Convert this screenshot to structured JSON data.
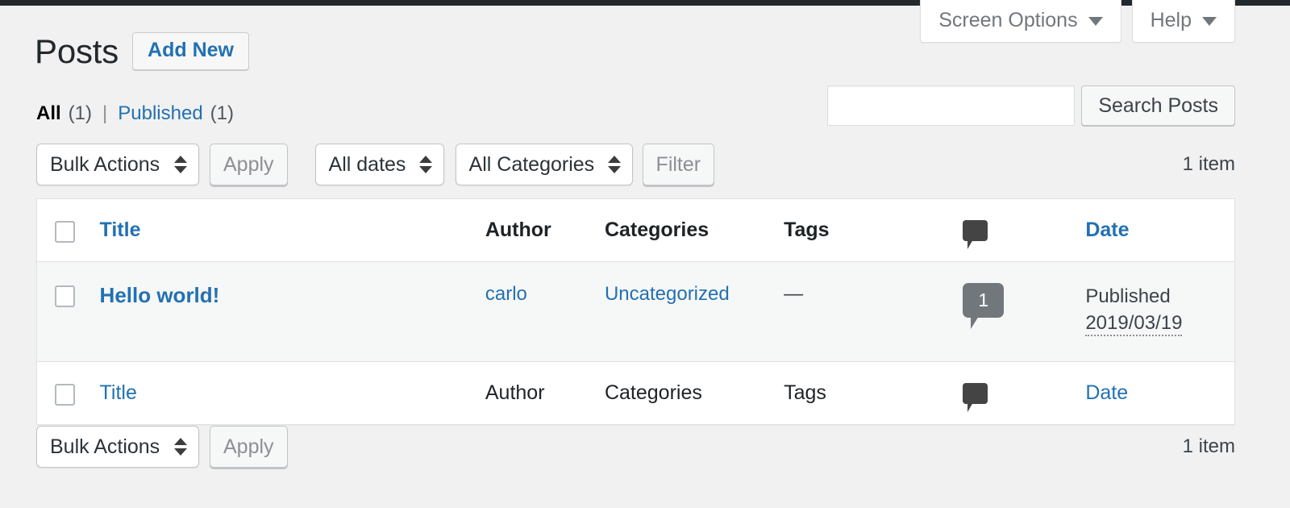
{
  "screen_meta": {
    "tabs": [
      {
        "label": "Screen Options",
        "icon": "chevron-down-icon"
      },
      {
        "label": "Help",
        "icon": "chevron-down-icon"
      }
    ]
  },
  "header": {
    "title": "Posts",
    "add_new_label": "Add New"
  },
  "views": {
    "all_label": "All",
    "all_count": "(1)",
    "separator": "|",
    "published_label": "Published",
    "published_count": "(1)"
  },
  "search": {
    "value": "",
    "placeholder": "",
    "submit_label": "Search Posts"
  },
  "tablenav_top": {
    "bulk_actions_selected": "Bulk Actions",
    "apply_label": "Apply",
    "dates_selected": "All dates",
    "categories_selected": "All Categories",
    "filter_label": "Filter",
    "displaying_num": "1 item"
  },
  "tablenav_bottom": {
    "bulk_actions_selected": "Bulk Actions",
    "apply_label": "Apply",
    "displaying_num": "1 item"
  },
  "table": {
    "columns": {
      "title": "Title",
      "author": "Author",
      "categories": "Categories",
      "tags": "Tags",
      "comments": "comment-bubble-icon",
      "date": "Date"
    },
    "rows": [
      {
        "title": "Hello world!",
        "author": "carlo",
        "categories": "Uncategorized",
        "tags": "—",
        "comments": "1",
        "date_status": "Published",
        "date_value": "2019/03/19"
      }
    ]
  },
  "colors": {
    "link": "#2271b1",
    "page_bg": "#f1f1f1",
    "row_bg": "#f6f7f7",
    "admin_bar": "#23282d",
    "comment_bubble": "#72777c",
    "icon_dark": "#444444"
  }
}
